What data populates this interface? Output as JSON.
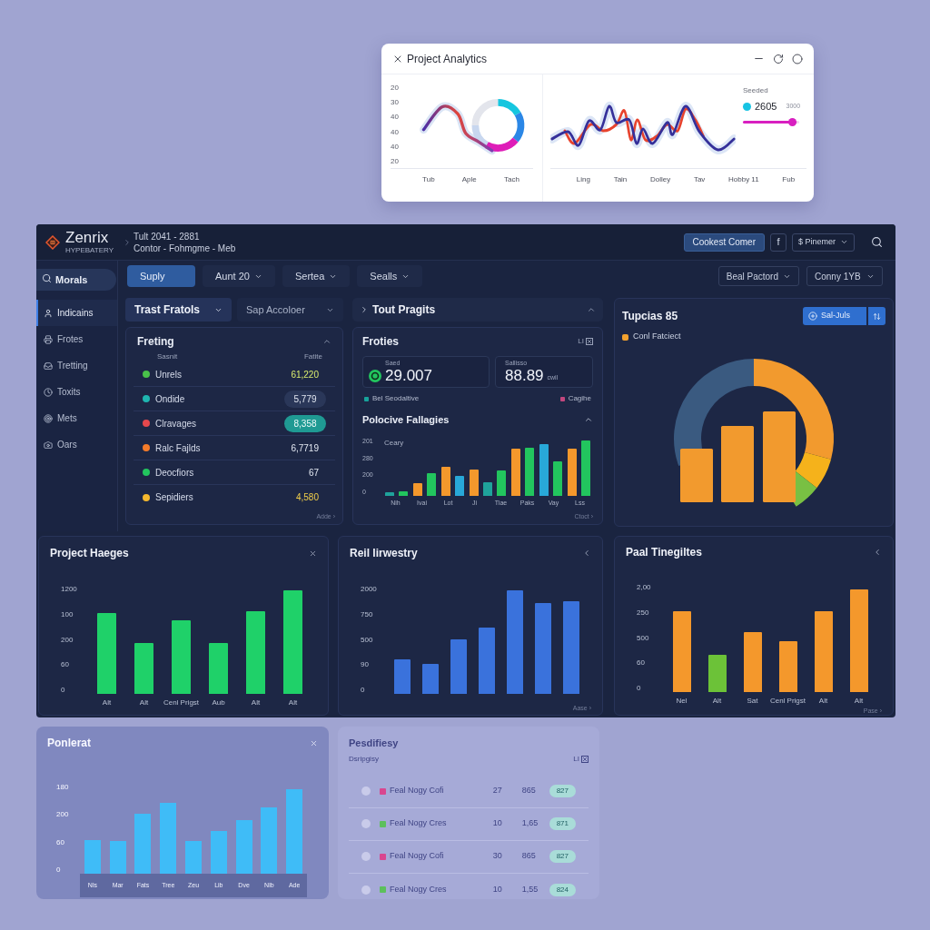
{
  "analytics_window": {
    "title": "Project Analytics",
    "left_chart": {
      "y_labels": [
        "20",
        "30",
        "40",
        "40",
        "40",
        "20"
      ],
      "x_labels": [
        "Tub",
        "Aple",
        "Tach"
      ]
    },
    "right_chart": {
      "legend_title": "Seeded",
      "legend_value": "2605",
      "legend_note": "3000",
      "level": 0.95,
      "x_labels": [
        "Ling",
        "Tain",
        "Dolley",
        "Tav",
        "Hobby 11",
        "Fub"
      ]
    }
  },
  "header": {
    "brand": "Zenrix",
    "tagline": "HYPEBATERY",
    "breadcrumb": [
      "Tult 2041 - 2881",
      "Contor - Fohmgme - Meb"
    ],
    "actions": [
      {
        "kind": "primary",
        "label": "Cookest Comer"
      },
      {
        "kind": "outline",
        "label": "f"
      },
      {
        "kind": "menu",
        "label": "$ Pinemer"
      }
    ]
  },
  "sidebar": {
    "search": {
      "value": "Morals"
    },
    "items": [
      {
        "label": "Indicains",
        "selected": true
      },
      {
        "label": "Frotes",
        "selected": false
      },
      {
        "label": "Tretting",
        "selected": false
      },
      {
        "label": "Toxits",
        "selected": false
      },
      {
        "label": "Mets",
        "selected": false
      },
      {
        "label": "Oars",
        "selected": false
      }
    ]
  },
  "toolbar": {
    "left": [
      {
        "kind": "primary",
        "label": "Suply"
      },
      {
        "kind": "dropdown",
        "label": "Aunt 20"
      },
      {
        "kind": "dropdown",
        "label": "Sertea"
      },
      {
        "kind": "dropdown",
        "label": "Sealls"
      }
    ],
    "right": [
      {
        "kind": "outlined",
        "label": "Beal Pactord"
      },
      {
        "kind": "select",
        "label": "Conny 1YB"
      }
    ]
  },
  "filters": [
    {
      "label": "Trast Fratols",
      "selected": true
    },
    {
      "label": "Sap Accoloer",
      "selected": false
    }
  ],
  "list_card": {
    "title": "Freting",
    "expanded": true,
    "columns": [
      "Sasnit",
      "Fatite"
    ],
    "rows": [
      {
        "kind": "lime",
        "name": "Unrels",
        "color": "#49c24a",
        "value": "61,220"
      },
      {
        "kind": "pill",
        "name": "Ondide",
        "color": "#1fb5b0",
        "value": "5,779"
      },
      {
        "kind": "accent",
        "name": "Clravages",
        "color": "#e5484d",
        "value": "8,358"
      },
      {
        "kind": "plain",
        "name": "Ralc Fajlds",
        "color": "#f47b2a",
        "value": "6,7719"
      },
      {
        "kind": "plain",
        "name": "Deocfiors",
        "color": "#22c55e",
        "value": "67"
      },
      {
        "kind": "yellow",
        "name": "Sepidiers",
        "color": "#f5b82e",
        "value": "4,580"
      }
    ],
    "footer": "Adde ›"
  },
  "summary_section": {
    "title": "Tout Pragits",
    "expanded": true
  },
  "stats_card": {
    "title": "Froties",
    "corner_label": "LI",
    "stats": [
      {
        "kind": "icon",
        "label": "Saed",
        "value": "29.007"
      },
      {
        "kind": "plain",
        "label": "Sallisso",
        "value": "88.89",
        "unit": "cwil"
      }
    ],
    "legend": [
      {
        "label": "Bel Seodaltive",
        "color": "#17a39b"
      },
      {
        "label": "Cagihe",
        "color": "#c2477e"
      }
    ],
    "chart": {
      "title": "Polocive Fallagies",
      "expanded": true,
      "series_label": "Ceary",
      "y_labels": [
        "201",
        "280",
        "200",
        "0"
      ],
      "x_labels": [
        "Nih",
        "Ivai",
        "Lot",
        "Ji",
        "Tiae",
        "Paks",
        "Vay",
        "Lss"
      ]
    },
    "footer": "Ctoct ›"
  },
  "donut_card": {
    "title": "Tupcias 85",
    "button": "Sal-Juls",
    "legend": "Conl Fatciect"
  },
  "bottom_cards": [
    {
      "kind": "close",
      "title": "Project Haeges",
      "y_labels": [
        "1200",
        "100",
        "200",
        "60",
        "0"
      ],
      "x_labels": [
        "Alt",
        "Alt",
        "Cenl Prigst",
        "Aub",
        "Alt",
        "Alt"
      ]
    },
    {
      "kind": "collapse",
      "title": "Reil Iirwestry",
      "y_labels": [
        "2000",
        "750",
        "500",
        "90",
        "0"
      ],
      "footer": "Aase ›"
    },
    {
      "kind": "collapse",
      "title": "Paal Tinegiltes",
      "y_labels": [
        "2,00",
        "250",
        "500",
        "60",
        "0"
      ],
      "x_labels": [
        "Nel",
        "Alt",
        "Sat",
        "Cenl Prigst",
        "Alt",
        "Alt"
      ],
      "footer": "Pase ›"
    }
  ],
  "faded_chart_panel": {
    "title": "Ponlerat",
    "y_labels": [
      "180",
      "200",
      "60",
      "0"
    ],
    "x_labels": [
      "Nls",
      "Mar",
      "Fats",
      "Tree",
      "Zeu",
      "Lib",
      "Dve",
      "Nlb",
      "Ade"
    ]
  },
  "faded_list_panel": {
    "title": "Pesdifiesy",
    "subtitle": "Dsripgisy",
    "corner_label": "LI",
    "rows": [
      {
        "checked": false,
        "color": "#d9468f",
        "name": "Feal Nogy Cofi",
        "count": "27",
        "amount": "865",
        "badge": "827"
      },
      {
        "checked": false,
        "color": "#5cc05c",
        "name": "Feal Nogy Cres",
        "count": "10",
        "amount": "1,65",
        "badge": "871"
      },
      {
        "checked": false,
        "color": "#d9468f",
        "name": "Feal Nogy Cofi",
        "count": "30",
        "amount": "865",
        "badge": "827"
      },
      {
        "checked": false,
        "color": "#5cc05c",
        "name": "Feal Nogy Cres",
        "count": "10",
        "amount": "1,55",
        "badge": "824"
      }
    ]
  }
}
